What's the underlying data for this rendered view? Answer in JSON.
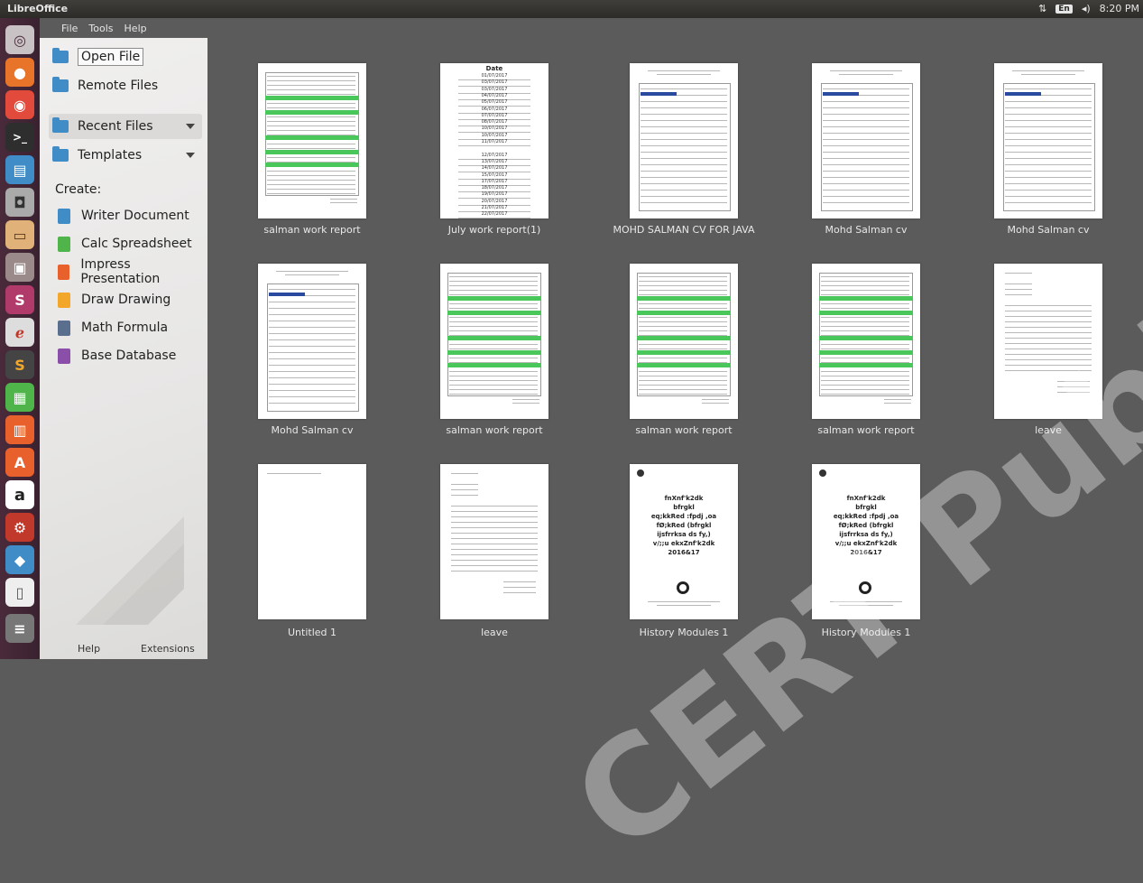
{
  "topbar": {
    "app_title": "LibreOffice",
    "lang": "En",
    "time": "8:20 PM"
  },
  "menu": [
    "File",
    "Tools",
    "Help"
  ],
  "sidebar": {
    "open_file": "Open File",
    "remote_files": "Remote Files",
    "recent_files": "Recent Files",
    "templates": "Templates",
    "create_label": "Create:",
    "create_items": [
      {
        "label": "Writer Document",
        "color": "#3f8cc6"
      },
      {
        "label": "Calc Spreadsheet",
        "color": "#4fb54a"
      },
      {
        "label": "Impress Presentation",
        "color": "#e8602c"
      },
      {
        "label": "Draw Drawing",
        "color": "#f2a72a"
      },
      {
        "label": "Math Formula",
        "color": "#5a6f8e"
      },
      {
        "label": "Base Database",
        "color": "#8a4fa8"
      }
    ],
    "help": "Help",
    "extensions": "Extensions"
  },
  "documents": [
    {
      "name": "salman work report",
      "type": "report"
    },
    {
      "name": "July work report(1)",
      "type": "dates"
    },
    {
      "name": "MOHD SALMAN CV FOR JAVA",
      "type": "cv"
    },
    {
      "name": "Mohd Salman cv",
      "type": "cv"
    },
    {
      "name": "Mohd Salman cv",
      "type": "cv"
    },
    {
      "name": "Mohd Salman cv",
      "type": "cv"
    },
    {
      "name": "salman work report",
      "type": "report"
    },
    {
      "name": "salman work report",
      "type": "report"
    },
    {
      "name": "salman work report",
      "type": "report"
    },
    {
      "name": "leave",
      "type": "letter"
    },
    {
      "name": "Untitled 1",
      "type": "blank"
    },
    {
      "name": "leave",
      "type": "letter"
    },
    {
      "name": "History Modules 1",
      "type": "history"
    },
    {
      "name": "History Modules 1",
      "type": "history"
    }
  ],
  "dates_doc": {
    "header": "Date",
    "rows": [
      "01/07/2017",
      "03/07/2017",
      "03/07/2017",
      "04/07/2017",
      "05/07/2017",
      "06/07/2017",
      "07/07/2017",
      "08/07/2017",
      "10/07/2017",
      "10/07/2017",
      "11/07/2017",
      "",
      "12/07/2017",
      "13/07/2017",
      "14/07/2017",
      "15/07/2017",
      "17/07/2017",
      "18/07/2017",
      "19/07/2017",
      "20/07/2017",
      "21/07/2017",
      "22/07/2017"
    ]
  },
  "history_doc": {
    "text": [
      "fnXnf'k2dk",
      "bfrgkl",
      "eq;kkRed :fpdj ,oa",
      "fØ;kRed (bfrgkl",
      "ijsfrrksa ds fy,)",
      "v/;;u ekxZnf'k2dk",
      "2016&17"
    ]
  },
  "watermark": "CERT Published"
}
